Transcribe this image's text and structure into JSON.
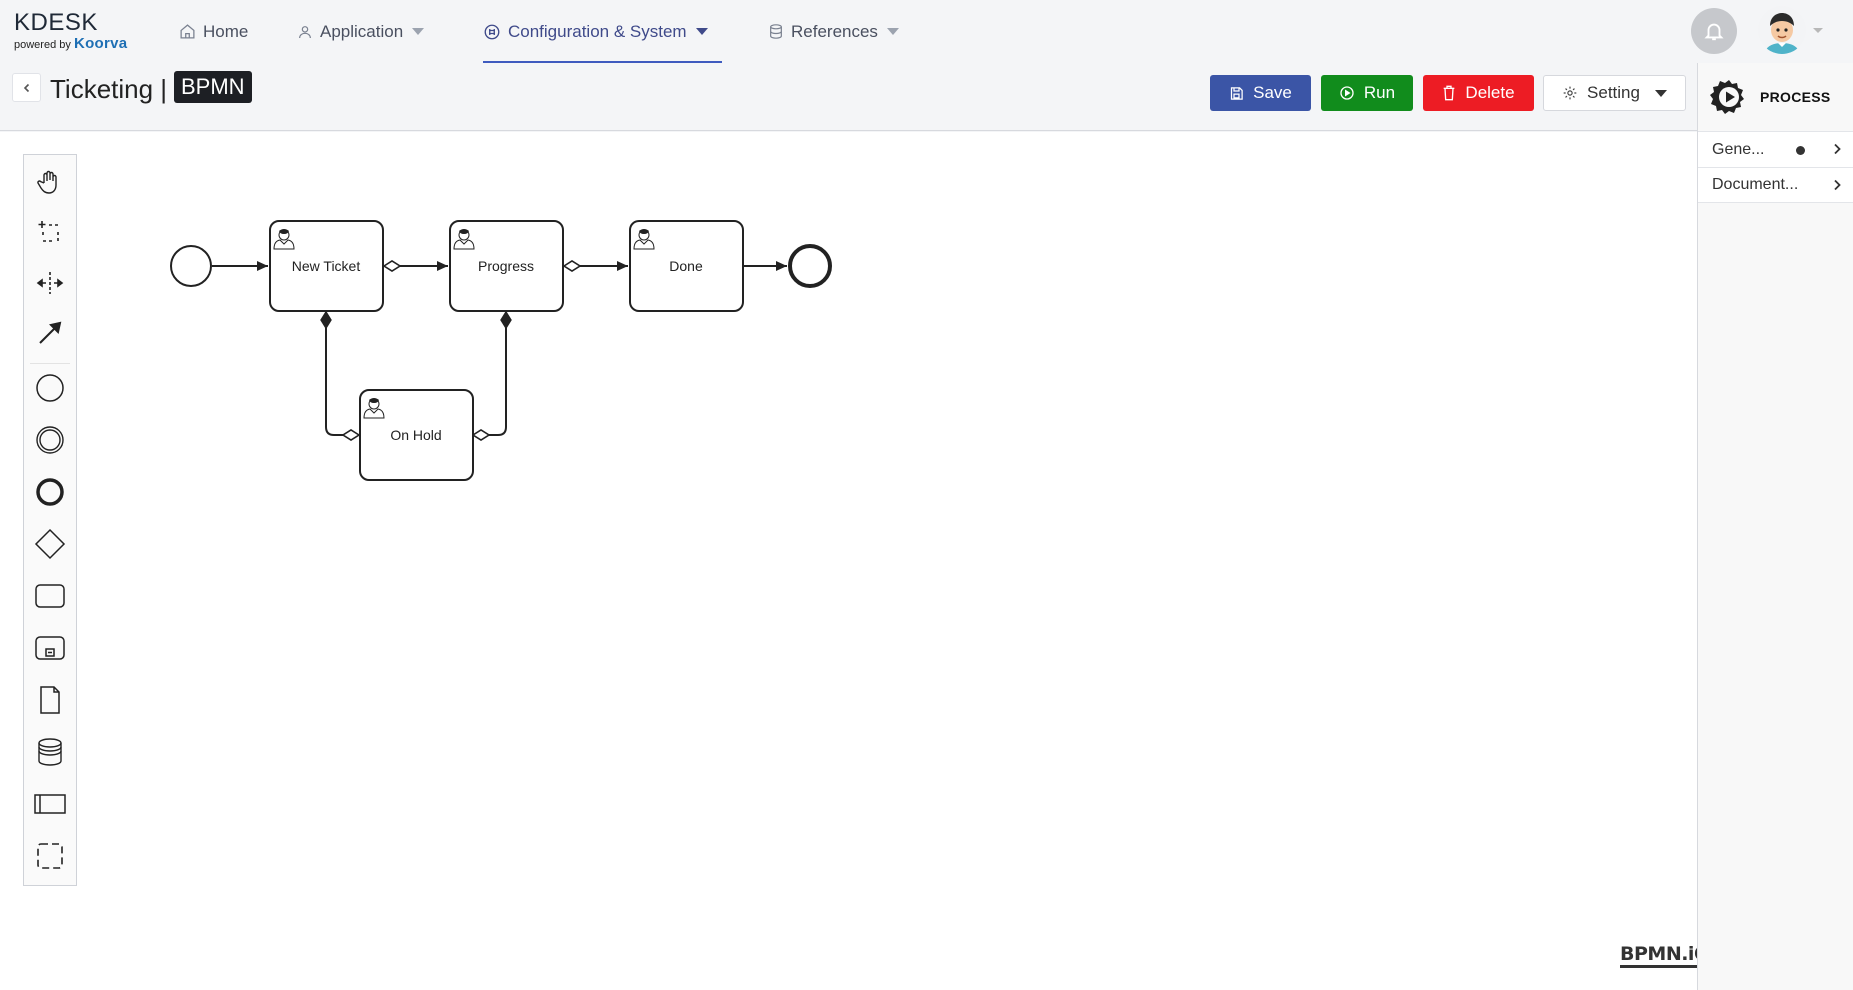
{
  "brand": {
    "name": "KDESK",
    "powered_by": "powered by",
    "vendor": "Koorva"
  },
  "nav": {
    "items": [
      {
        "label": "Home",
        "icon": "home-icon"
      },
      {
        "label": "Application",
        "icon": "user-icon",
        "has_dropdown": true
      },
      {
        "label": "Configuration & System",
        "icon": "settings-dial-icon",
        "has_dropdown": true,
        "active": true
      },
      {
        "label": "References",
        "icon": "database-icon",
        "has_dropdown": true
      }
    ],
    "notification_icon": "bell-icon",
    "avatar_icon": "user-avatar"
  },
  "header": {
    "title": "Ticketing |",
    "tag": "BPMN",
    "buttons": {
      "save": "Save",
      "run": "Run",
      "delete": "Delete",
      "setting": "Setting"
    }
  },
  "palette": {
    "tools": [
      "hand-tool-icon",
      "lasso-tool-icon",
      "space-tool-icon",
      "connect-tool-icon",
      "start-event-icon",
      "intermediate-event-icon",
      "end-event-icon",
      "gateway-icon",
      "task-icon",
      "subprocess-icon",
      "data-object-icon",
      "data-store-icon",
      "pool-icon",
      "group-icon"
    ]
  },
  "diagram": {
    "tasks": [
      {
        "id": "new_ticket",
        "label": "New Ticket",
        "type": "user-task"
      },
      {
        "id": "progress",
        "label": "Progress",
        "type": "user-task"
      },
      {
        "id": "done",
        "label": "Done",
        "type": "user-task"
      },
      {
        "id": "on_hold",
        "label": "On Hold",
        "type": "user-task"
      }
    ],
    "events": [
      {
        "id": "start",
        "type": "start-event"
      },
      {
        "id": "end",
        "type": "end-event"
      }
    ],
    "flows": [
      {
        "from": "start",
        "to": "new_ticket"
      },
      {
        "from": "new_ticket",
        "to": "progress"
      },
      {
        "from": "progress",
        "to": "done"
      },
      {
        "from": "done",
        "to": "end"
      },
      {
        "from": "on_hold",
        "to": "new_ticket"
      },
      {
        "from": "on_hold",
        "to": "progress"
      }
    ],
    "watermark": "BPMN.iO"
  },
  "properties_panel": {
    "title": "PROCESS",
    "sections": [
      {
        "label": "Gene...",
        "has_indicator": true
      },
      {
        "label": "Document...",
        "has_indicator": false
      }
    ]
  },
  "colors": {
    "save": "#3b55a6",
    "run": "#118c1c",
    "delete": "#ed1c24",
    "nav_active": "#3f4a8a"
  }
}
